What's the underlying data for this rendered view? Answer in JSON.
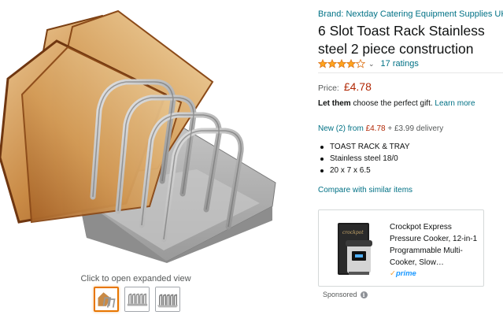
{
  "gallery": {
    "expand_caption": "Click to open expanded view",
    "thumbnails": [
      {
        "selected": true
      },
      {
        "selected": false
      },
      {
        "selected": false
      }
    ]
  },
  "product": {
    "brand_link": "Brand: Nextday Catering Equipment Supplies UK",
    "title": "6 Slot Toast Rack Stainless steel 2 piece construction",
    "rating": 4,
    "ratings_count": "17 ratings",
    "price_label": "Price:",
    "price": "£4.78",
    "gift_bold": "Let them",
    "gift_text": " choose the perfect gift. ",
    "gift_link": "Learn more",
    "offers_link": "New (2) from ",
    "offers_price": "£4.78",
    "offers_delivery": " + £3.99 delivery",
    "bullets": [
      "TOAST RACK & TRAY",
      "Stainless steel 18/0",
      "20 x 7 x 6.5"
    ],
    "compare_link": "Compare with similar items"
  },
  "sponsored_ad": {
    "title": "Crockpot Express Pressure Cooker, 12-in-1 Programmable Multi-Cooker, Slow…",
    "prime_label": "prime",
    "sponsored_label": "Sponsored",
    "icon": "info-icon"
  },
  "colors": {
    "link": "#007185",
    "price": "#b12704",
    "star": "#ffa41c",
    "thumb_selected": "#e77600"
  }
}
